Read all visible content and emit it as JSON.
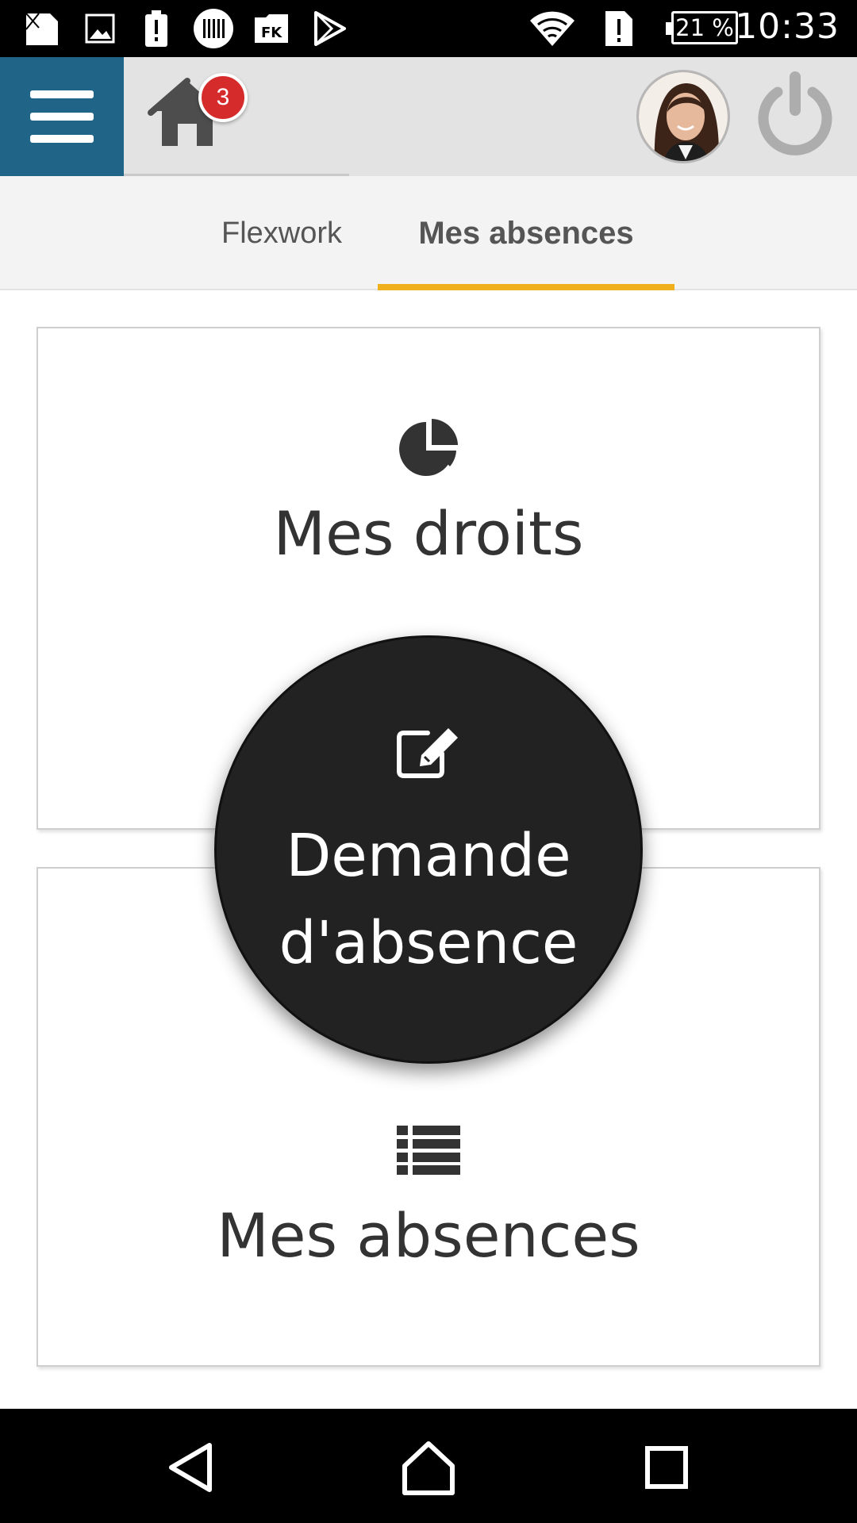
{
  "status_bar": {
    "battery": "21 %",
    "time": "10:33"
  },
  "header": {
    "notification_count": "3"
  },
  "tabs": [
    {
      "label": "Flexwork"
    },
    {
      "label": "Mes absences"
    }
  ],
  "cards": {
    "rights": {
      "label": "Mes droits"
    },
    "absences": {
      "label": "Mes absences"
    }
  },
  "fab": {
    "line1": "Demande",
    "line2": "d'absence"
  },
  "colors": {
    "menu": "#206487",
    "tab_indicator": "#f0b01b",
    "badge": "#d62b2b",
    "fab": "#222222"
  }
}
